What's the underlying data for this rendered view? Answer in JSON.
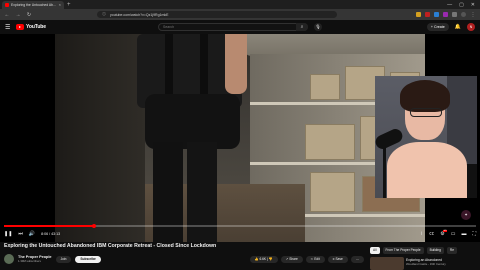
{
  "browser": {
    "tab_title": "Exploring the Untouched Ab...",
    "url": "youtube.com/watch?v=Qz1j9Rg1mkE",
    "new_tab": "+",
    "controls": [
      "—",
      "▢",
      "✕"
    ]
  },
  "youtube": {
    "logo_text": "YouTube",
    "search_placeholder": "Search",
    "create_label": "+ Create",
    "avatar_letter": "N",
    "colors": {
      "accent": "#ff0000",
      "bg": "#0f0f0f",
      "pill": "#272727"
    }
  },
  "player": {
    "time": "8:06 / 43:13",
    "progress_fraction": 0.19
  },
  "video": {
    "title": "Exploring the Untouched Abandoned IBM Corporate Retreat - Closed Since Lockdown",
    "channel_name": "The Proper People",
    "subscribers": "1.39M subscribers",
    "join_label": "Join",
    "subscribe_label": "Subscribe",
    "likes": "6.6K",
    "share_label": "Share",
    "remix_label": "Edit",
    "save_label": "Save",
    "more_label": "⋯"
  },
  "sidebar": {
    "chips": [
      {
        "label": "All",
        "active": true
      },
      {
        "label": "From The Proper People",
        "active": false
      },
      {
        "label": "Building",
        "active": false
      },
      {
        "label": "Re",
        "active": false
      }
    ],
    "rec_title": "Exploring an Abandoned",
    "rec_channel": "Woodland Castle - 19th Century"
  }
}
